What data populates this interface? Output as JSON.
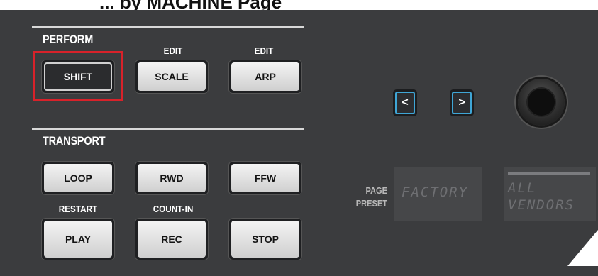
{
  "caption": "... by MACHINE Page",
  "sections": {
    "perform": "PERFORM",
    "transport": "TRANSPORT"
  },
  "perform": {
    "shift": "SHIFT",
    "scale": "SCALE",
    "arp": "ARP",
    "scale_alt": "EDIT",
    "arp_alt": "EDIT"
  },
  "transport": {
    "loop": "LOOP",
    "rwd": "RWD",
    "ffw": "FFW",
    "play": "PLAY",
    "rec": "REC",
    "stop": "STOP",
    "play_alt": "RESTART",
    "rec_alt": "COUNT-IN"
  },
  "nav": {
    "left": "<",
    "right": ">"
  },
  "display": {
    "labels": [
      "PAGE",
      "PRESET"
    ],
    "lcd1": "FACTORY",
    "lcd2_line1": "ALL",
    "lcd2_line2": "VENDORS"
  },
  "colors": {
    "highlight": "#d8222a",
    "nav_accent": "#3fa6d6",
    "panel": "#3b3c3e"
  }
}
